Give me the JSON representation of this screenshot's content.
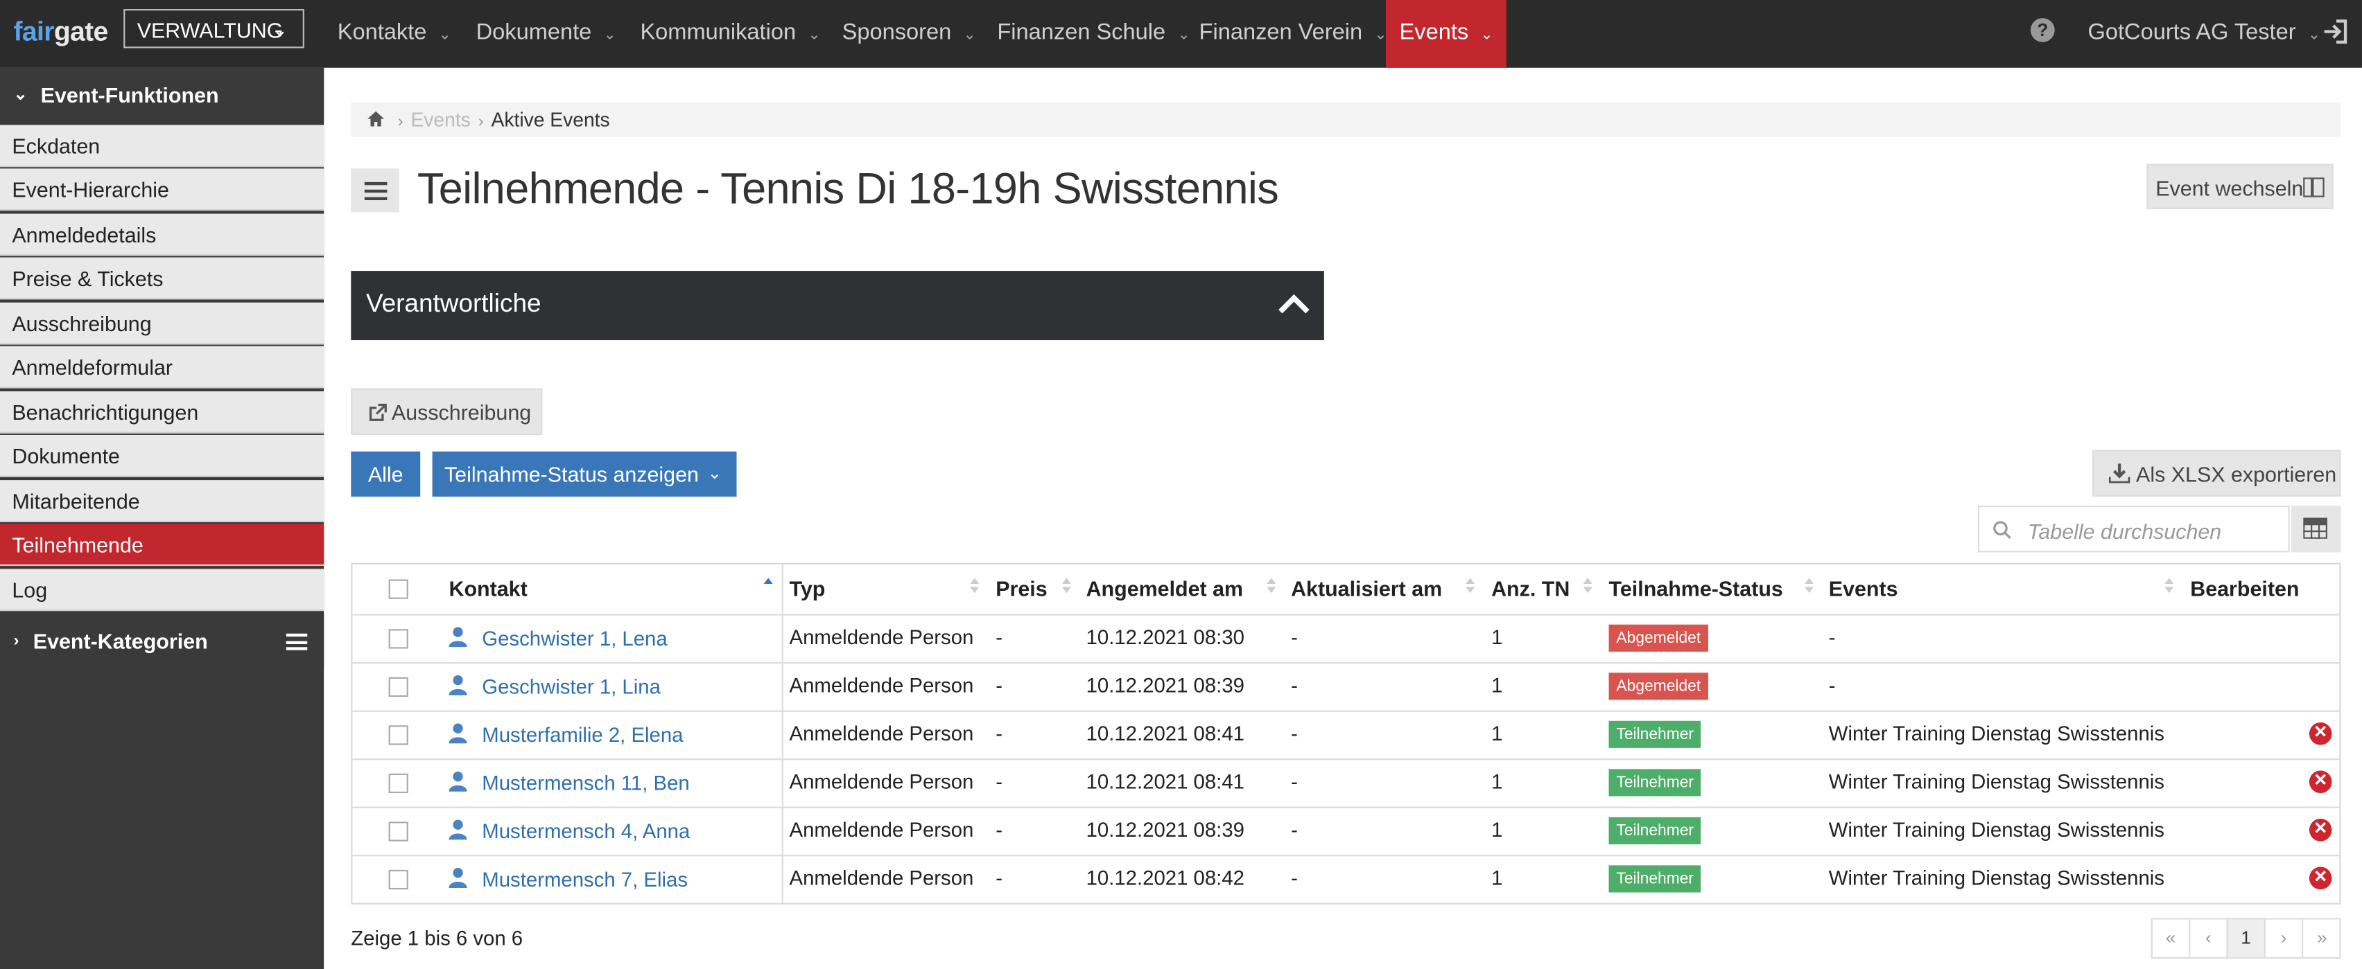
{
  "topbar": {
    "logo_part1": "fair",
    "logo_part2": "gate",
    "area_selector": "VERWALTUNG",
    "nav": [
      "Kontakte",
      "Dokumente",
      "Kommunikation",
      "Sponsoren",
      "Finanzen Schule",
      "Finanzen Verein",
      "Events"
    ],
    "active_nav": "Events",
    "user": "GotCourts AG Tester"
  },
  "sidebar": {
    "section1": "Event-Funktionen",
    "items": [
      "Eckdaten",
      "Event-Hierarchie",
      "Anmeldedetails",
      "Preise & Tickets",
      "Ausschreibung",
      "Anmeldeformular",
      "Benachrichtigungen",
      "Dokumente",
      "Mitarbeitende",
      "Teilnehmende",
      "Log"
    ],
    "active_item": "Teilnehmende",
    "section2": "Event-Kategorien"
  },
  "breadcrumb": {
    "level1": "Events",
    "level2": "Aktive Events"
  },
  "page_title": "Teilnehmende - Tennis Di 18-19h Swisstennis",
  "event_switch_label": "Event wechseln",
  "panel_title": "Verantwortliche",
  "ausschreibung_label": "Ausschreibung",
  "filter": {
    "all_label": "Alle",
    "status_label": "Teilnahme-Status anzeigen"
  },
  "export_label": "Als XLSX exportieren",
  "search_placeholder": "Tabelle durchsuchen",
  "table": {
    "headers": [
      "Kontakt",
      "Typ",
      "Preis",
      "Angemeldet am",
      "Aktualisiert am",
      "Anz. TN",
      "Teilnahme-Status",
      "Events",
      "Bearbeiten"
    ],
    "rows": [
      {
        "kontakt": "Geschwister 1, Lena",
        "typ": "Anmeldende Person",
        "preis": "-",
        "angemeldet": "10.12.2021 08:30",
        "aktualisiert": "-",
        "anz": "1",
        "status": "Abgemeldet",
        "status_color": "#d9534f",
        "events": "-",
        "removable": false
      },
      {
        "kontakt": "Geschwister 1, Lina",
        "typ": "Anmeldende Person",
        "preis": "-",
        "angemeldet": "10.12.2021 08:39",
        "aktualisiert": "-",
        "anz": "1",
        "status": "Abgemeldet",
        "status_color": "#d9534f",
        "events": "-",
        "removable": false
      },
      {
        "kontakt": "Musterfamilie 2, Elena",
        "typ": "Anmeldende Person",
        "preis": "-",
        "angemeldet": "10.12.2021 08:41",
        "aktualisiert": "-",
        "anz": "1",
        "status": "Teilnehmer",
        "status_color": "#4cae68",
        "events": "Winter Training Dienstag Swisstennis",
        "removable": true
      },
      {
        "kontakt": "Mustermensch 11, Ben",
        "typ": "Anmeldende Person",
        "preis": "-",
        "angemeldet": "10.12.2021 08:41",
        "aktualisiert": "-",
        "anz": "1",
        "status": "Teilnehmer",
        "status_color": "#4cae68",
        "events": "Winter Training Dienstag Swisstennis",
        "removable": true
      },
      {
        "kontakt": "Mustermensch 4, Anna",
        "typ": "Anmeldende Person",
        "preis": "-",
        "angemeldet": "10.12.2021 08:39",
        "aktualisiert": "-",
        "anz": "1",
        "status": "Teilnehmer",
        "status_color": "#4cae68",
        "events": "Winter Training Dienstag Swisstennis",
        "removable": true
      },
      {
        "kontakt": "Mustermensch 7, Elias",
        "typ": "Anmeldende Person",
        "preis": "-",
        "angemeldet": "10.12.2021 08:42",
        "aktualisiert": "-",
        "anz": "1",
        "status": "Teilnehmer",
        "status_color": "#4cae68",
        "events": "Winter Training Dienstag Swisstennis",
        "removable": true
      }
    ]
  },
  "footer_info": "Zeige 1 bis 6 von 6",
  "pagination": {
    "current_page": "1"
  },
  "icons": {
    "help": "help-icon",
    "logout": "logout-icon",
    "home": "home-icon",
    "menu": "hamburger-icon",
    "layout": "layout-icon",
    "external": "external-link-icon",
    "download": "download-icon",
    "search": "search-icon",
    "table": "table-icon",
    "user": "user-icon",
    "remove": "remove-icon"
  }
}
